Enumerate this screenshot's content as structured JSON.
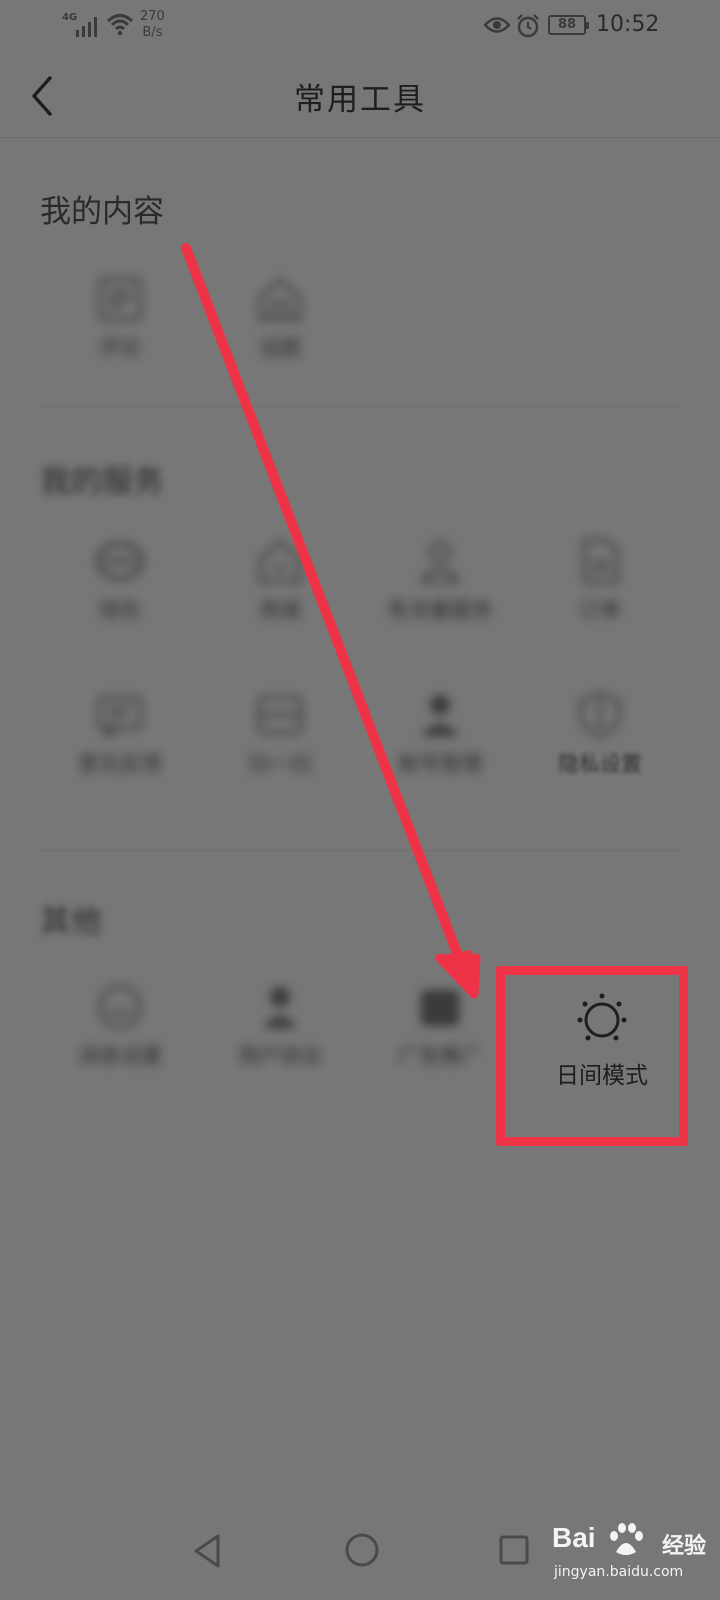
{
  "status_bar": {
    "network": "4G",
    "speed_value": "270",
    "speed_unit": "B/s",
    "battery": "88",
    "time": "10:52",
    "icons": [
      "signal-icon",
      "wifi-icon",
      "eye-icon",
      "alarm-icon",
      "battery-icon"
    ]
  },
  "header": {
    "title": "常用工具",
    "back_icon": "chevron-left-icon"
  },
  "sections": {
    "my_content": {
      "title": "我的内容",
      "items": [
        {
          "label": "评论",
          "icon": "document-icon"
        },
        {
          "label": "话题",
          "icon": "house-icon"
        }
      ]
    },
    "my_services": {
      "title": "我的服务",
      "items": [
        {
          "label": "钱包",
          "icon": "coin-icon"
        },
        {
          "label": "商城",
          "icon": "house-icon"
        },
        {
          "label": "免流量服务",
          "icon": "person-icon"
        },
        {
          "label": "订单",
          "icon": "document-icon"
        },
        {
          "label": "意见反馈",
          "icon": "message-icon"
        },
        {
          "label": "扫一扫",
          "icon": "scan-icon"
        },
        {
          "label": "账号管理",
          "icon": "person-icon"
        },
        {
          "label": "隐私设置",
          "icon": "shield-icon"
        }
      ]
    },
    "other": {
      "title": "其他",
      "items": [
        {
          "label": "消息设置",
          "icon": "bell-icon"
        },
        {
          "label": "用户协议",
          "icon": "person-icon"
        },
        {
          "label": "广告推广",
          "icon": "megaphone-icon"
        }
      ],
      "day_mode": {
        "label": "日间模式",
        "icon": "sun-icon"
      }
    }
  },
  "annotation": {
    "color": "#ee3346"
  },
  "nav_bar": {
    "icons": [
      "nav-back-icon",
      "nav-home-icon",
      "nav-recent-icon"
    ]
  },
  "watermark": {
    "brand": "Bai",
    "brand_cn": "经验",
    "url": "jingyan.baidu.com"
  }
}
